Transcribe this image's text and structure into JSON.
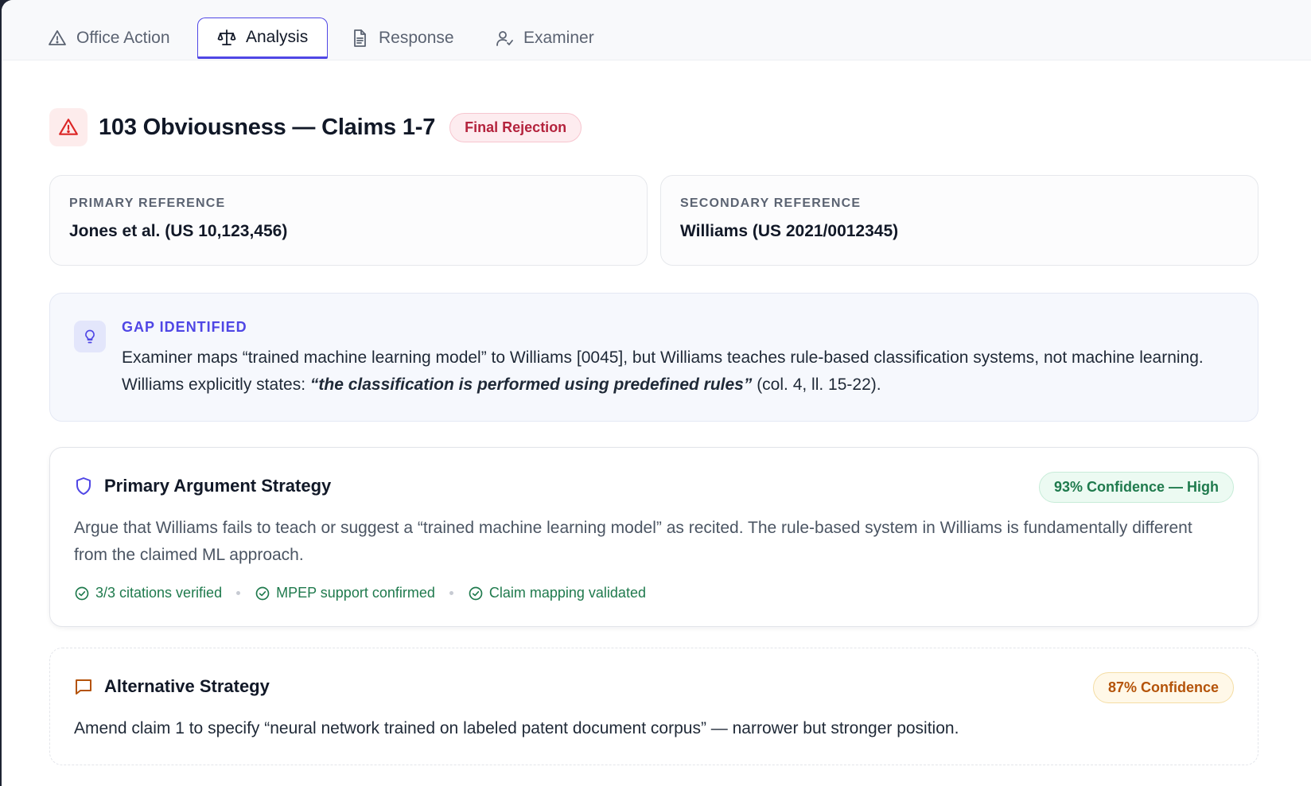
{
  "tabs": [
    {
      "label": "Office Action",
      "icon": "warning-triangle-icon"
    },
    {
      "label": "Analysis",
      "icon": "scale-icon",
      "active": true
    },
    {
      "label": "Response",
      "icon": "document-icon"
    },
    {
      "label": "Examiner",
      "icon": "user-check-icon"
    }
  ],
  "header": {
    "title": "103 Obviousness — Claims 1-7",
    "status_badge": "Final Rejection"
  },
  "references": {
    "primary": {
      "label": "PRIMARY REFERENCE",
      "value": "Jones et al. (US 10,123,456)"
    },
    "secondary": {
      "label": "SECONDARY REFERENCE",
      "value": "Williams (US 2021/0012345)"
    }
  },
  "gap": {
    "label": "GAP IDENTIFIED",
    "text_before": "Examiner maps “trained machine learning model” to Williams [0045], but Williams teaches rule-based classification systems, not machine learning. Williams explicitly states: ",
    "quote": "“the classification is performed using predefined rules”",
    "text_after": " (col. 4, ll. 15-22)."
  },
  "primary_strategy": {
    "title": "Primary Argument Strategy",
    "confidence": "93% Confidence — High",
    "body": "Argue that Williams fails to teach or suggest a “trained machine learning model” as recited. The rule-based system in Williams is fundamentally different from the claimed ML approach.",
    "checks": [
      "3/3 citations verified",
      "MPEP support confirmed",
      "Claim mapping validated"
    ]
  },
  "alternative_strategy": {
    "title": "Alternative Strategy",
    "confidence": "87% Confidence",
    "body": "Amend claim 1 to specify “neural network trained on labeled patent document corpus” — narrower but stronger position."
  },
  "colors": {
    "accent": "#4f46e5",
    "danger": "#dc2626",
    "success": "#1f7a4d",
    "warning": "#b45309"
  }
}
